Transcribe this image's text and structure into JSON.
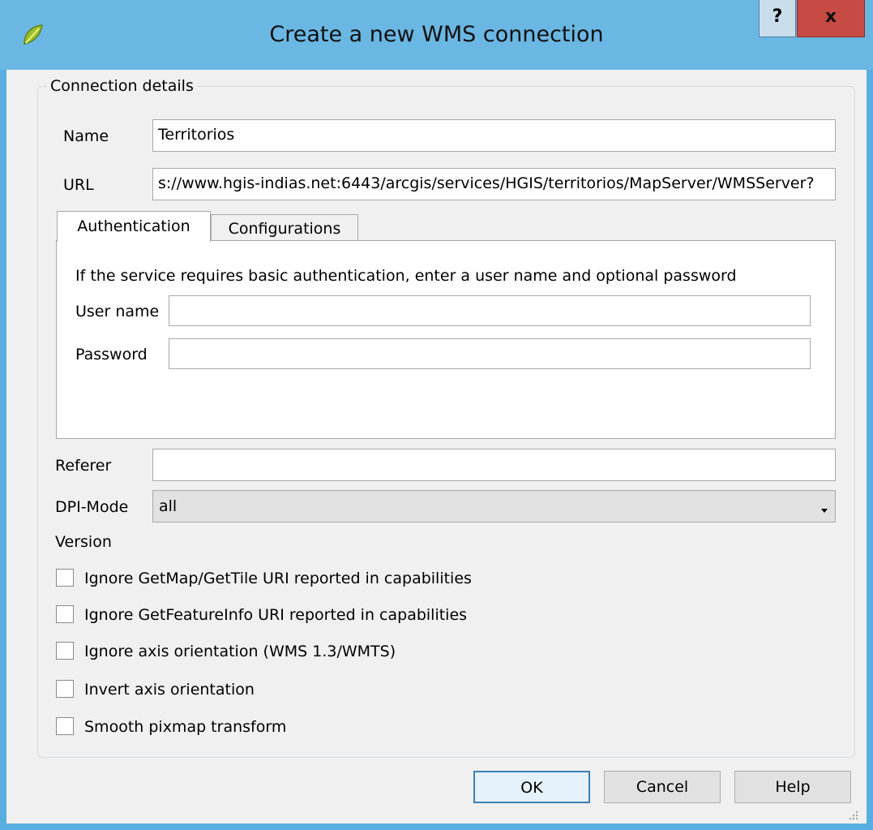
{
  "window": {
    "title": "Create a new WMS connection",
    "help_label": "?",
    "close_label": "x"
  },
  "group": {
    "title": "Connection details"
  },
  "name": {
    "label": "Name",
    "value": "Territorios"
  },
  "url": {
    "label": "URL",
    "value": "s://www.hgis-indias.net:6443/arcgis/services/HGIS/territorios/MapServer/WMSServer?"
  },
  "tabs": [
    {
      "label": "Authentication",
      "active": true
    },
    {
      "label": "Configurations",
      "active": false
    }
  ],
  "auth": {
    "info": "If the service requires basic authentication, enter a user name and optional password",
    "username_label": "User name",
    "username_value": "",
    "password_label": "Password",
    "password_value": ""
  },
  "referer": {
    "label": "Referer",
    "value": ""
  },
  "dpi_mode": {
    "label": "DPI-Mode",
    "value": "all"
  },
  "version": {
    "label": "Version"
  },
  "checkboxes": [
    {
      "label": "Ignore GetMap/GetTile URI reported in capabilities",
      "checked": false
    },
    {
      "label": "Ignore GetFeatureInfo URI reported in capabilities",
      "checked": false
    },
    {
      "label": "Ignore axis orientation (WMS 1.3/WMTS)",
      "checked": false
    },
    {
      "label": "Invert axis orientation",
      "checked": false
    },
    {
      "label": "Smooth pixmap transform",
      "checked": false
    }
  ],
  "buttons": {
    "ok": "OK",
    "cancel": "Cancel",
    "help": "Help"
  },
  "colors": {
    "titlebar": "#6ab7e3",
    "close": "#c74a44",
    "default_button_border": "#3c7fb1"
  },
  "icons": {
    "app": "qgis-logo-icon",
    "combo": "chevron-down-icon",
    "grip": "resize-grip-icon"
  }
}
